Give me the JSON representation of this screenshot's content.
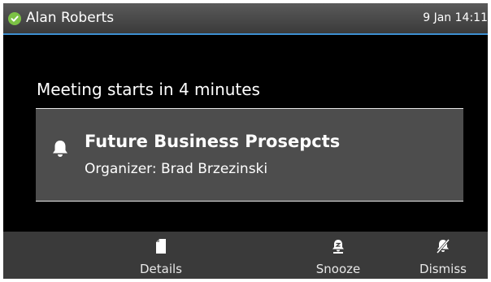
{
  "status_bar": {
    "user_name": "Alan Roberts",
    "presence_status_color": "#7cc245",
    "date": "9 Jan",
    "time": "14:11"
  },
  "reminder": {
    "title": "Meeting starts in 4 minutes",
    "icon": "bell-icon",
    "subject": "Future Business Prosepcts",
    "organizer_label": "Organizer: Brad Brzezinski"
  },
  "softkeys": [
    {
      "label": "Details",
      "icon": "document-icon"
    },
    {
      "label": "Snooze",
      "icon": "snooze-bell-icon"
    },
    {
      "label": "Dismiss",
      "icon": "bell-off-icon"
    }
  ],
  "colors": {
    "accent": "#3d8fd1",
    "background": "#000000",
    "card": "#4d4d4d",
    "softkey_bar": "#3a3a3a"
  }
}
